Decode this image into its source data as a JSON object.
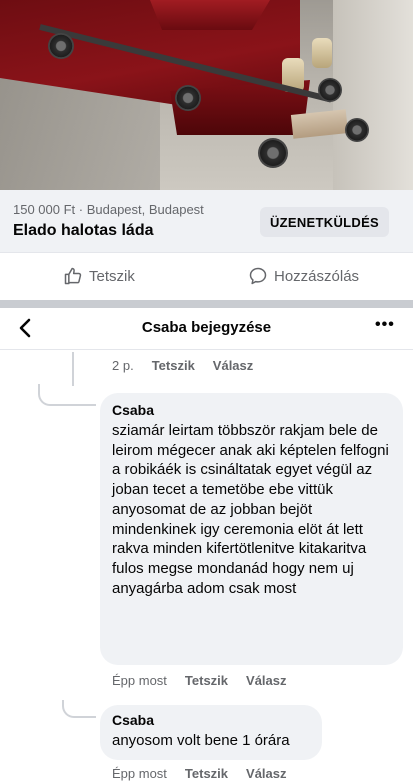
{
  "listing": {
    "price_location": "150 000 Ft · Budapest, Budapest",
    "title": "Elado halotas láda",
    "message_button": "ÜZENETKÜLDÉS"
  },
  "actions": {
    "like": "Tetszik",
    "comment": "Hozzászólás"
  },
  "thread": {
    "title": "Csaba bejegyzése",
    "more": "•••"
  },
  "comments": [
    {
      "time": "2 p.",
      "like": "Tetszik",
      "reply": "Válasz"
    },
    {
      "author": "Csaba",
      "text": "sziamár leirtam többször rakjam bele de leirom mégecer anak aki képtelen felfogni a robikáék is csináltatak egyet végül az joban tecet a temetöbe ebe vittük anyosomat de az jobban bejöt mindenkinek igy ceremonia elöt át lett rakva minden kifertötlenitve kitakaritva fulos megse mondanád hogy nem uj anyagárba adom csak most",
      "time": "Épp most",
      "like": "Tetszik",
      "reply": "Válasz"
    },
    {
      "author": "Csaba",
      "text": "anyosom volt bene 1 órára",
      "time": "Épp most",
      "like": "Tetszik",
      "reply": "Válasz"
    }
  ],
  "icons": {
    "back": "chevron-left-icon",
    "like": "thumbs-up-icon",
    "comment": "speech-bubble-icon"
  },
  "colors": {
    "secondary_text": "#65676b",
    "bubble_bg": "#f0f2f5",
    "coffin_red": "#8a1319"
  }
}
